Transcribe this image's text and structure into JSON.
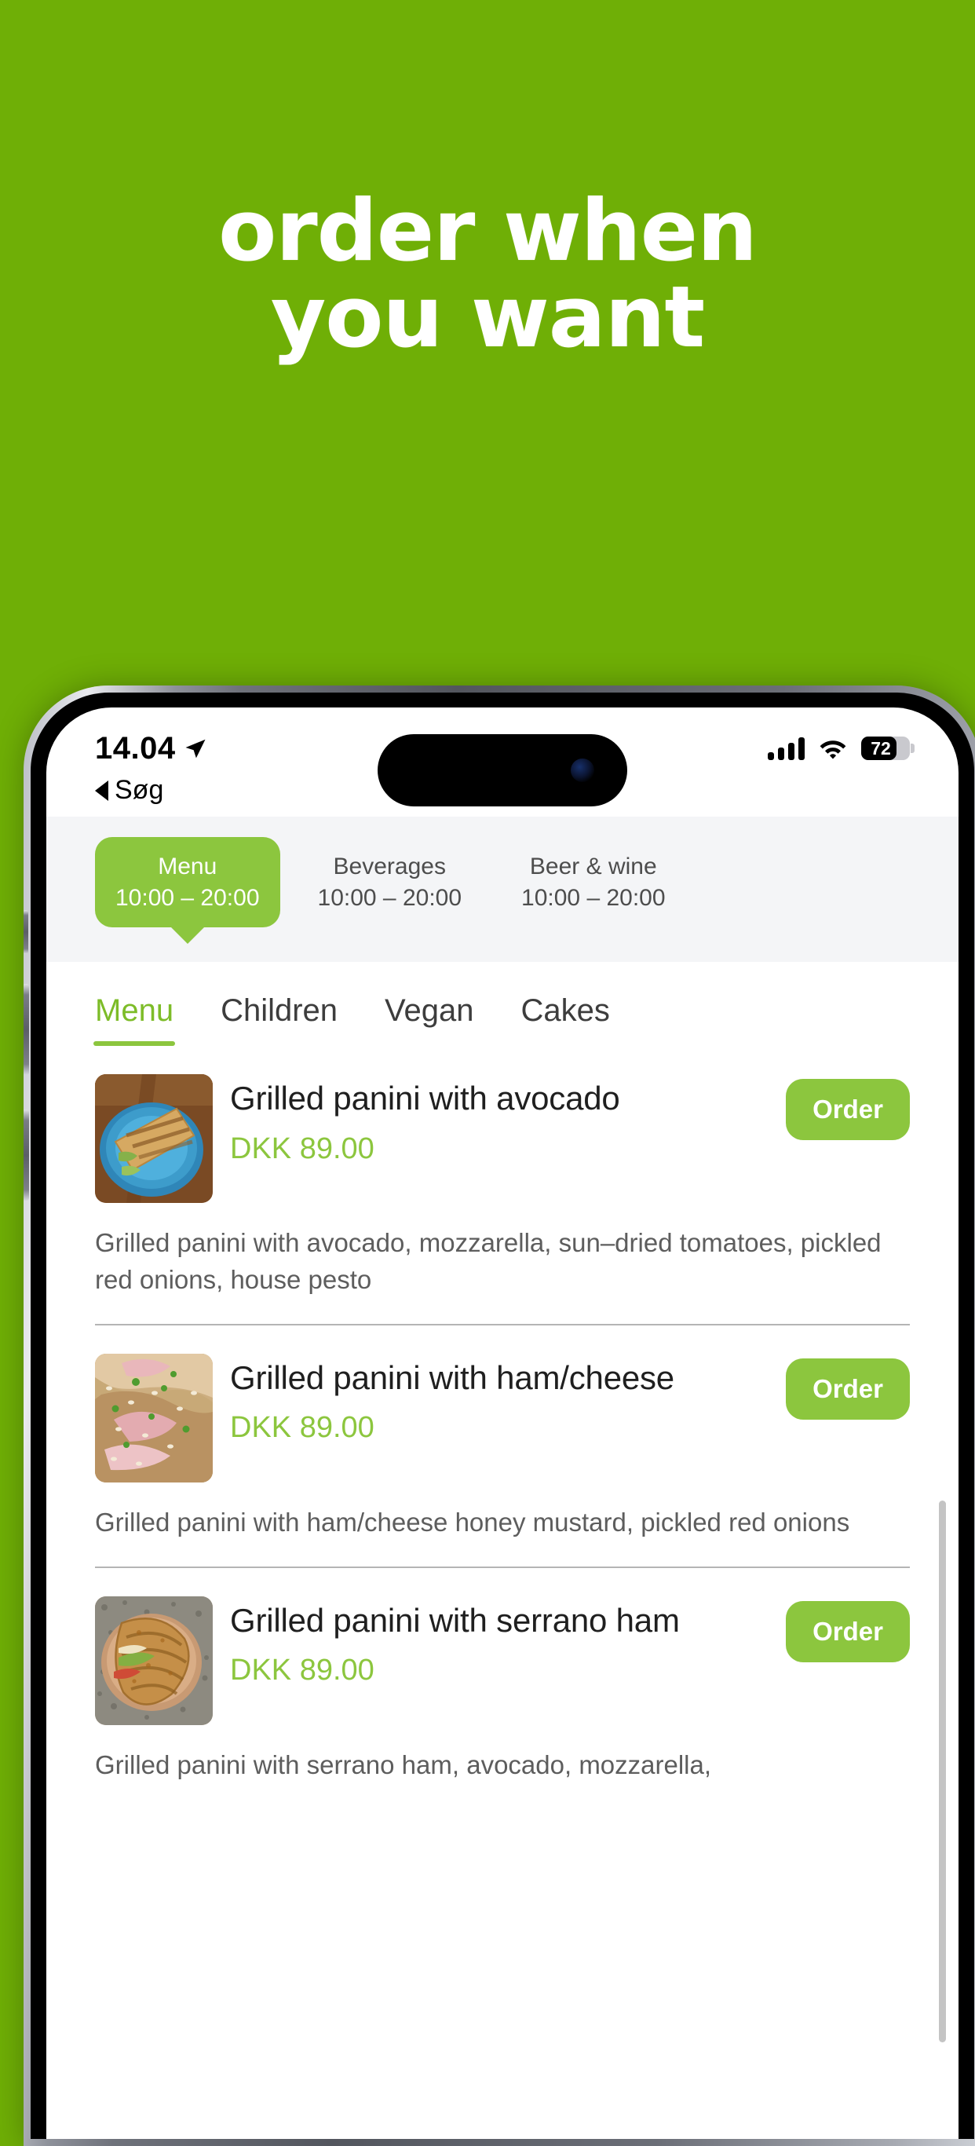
{
  "promo": {
    "line1": "order when",
    "line2": "you want",
    "background_color": "#6FAF06",
    "text_color": "#FFFFFF"
  },
  "brand": {
    "accent_green": "#8CC63E",
    "tab_active_green": "#7DBC28"
  },
  "status_bar": {
    "time": "14.04",
    "location_icon": "location-arrow-icon",
    "signal_icon": "cellular-signal-icon",
    "wifi_icon": "wifi-icon",
    "battery_percent": "72",
    "battery_level": 72
  },
  "back_nav": {
    "caret_icon": "back-caret-icon",
    "label": "Søg"
  },
  "schedule": {
    "items": [
      {
        "name": "Menu",
        "hours": "10:00 – 20:00",
        "active": true
      },
      {
        "name": "Beverages",
        "hours": "10:00 – 20:00",
        "active": false
      },
      {
        "name": "Beer & wine",
        "hours": "10:00 – 20:00",
        "active": false
      }
    ]
  },
  "tabs": [
    {
      "label": "Menu",
      "active": true
    },
    {
      "label": "Children",
      "active": false
    },
    {
      "label": "Vegan",
      "active": false
    },
    {
      "label": "Cakes",
      "active": false
    }
  ],
  "order_button_label": "Order",
  "menu_items": [
    {
      "title": "Grilled panini with avocado",
      "price": "DKK 89.00",
      "description": "Grilled panini with avocado, mozzarella, sun–dried tomatoes, pickled red onions, house pesto",
      "thumb_alt": "grilled-panini-on-blue-plate-photo",
      "order_label": "Order"
    },
    {
      "title": "Grilled panini with ham/cheese",
      "price": "DKK 89.00",
      "description": "Grilled panini with ham/cheese honey mustard, pickled red onions",
      "thumb_alt": "ham-cheese-sandwich-photo",
      "order_label": "Order"
    },
    {
      "title": "Grilled panini with serrano ham",
      "price": "DKK 89.00",
      "description": "Grilled panini with serrano ham, avocado, mozzarella,",
      "thumb_alt": "serrano-ham-panini-photo",
      "order_label": "Order"
    }
  ]
}
